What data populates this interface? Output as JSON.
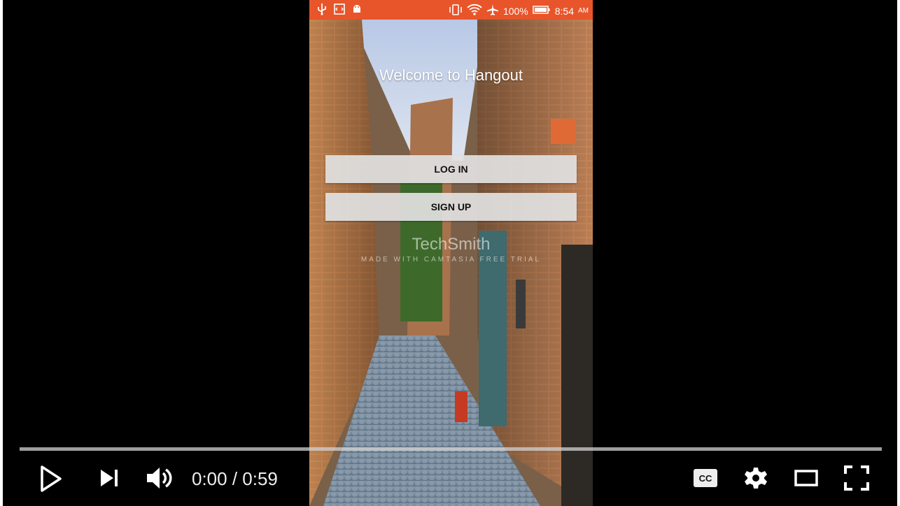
{
  "phone": {
    "status_bar": {
      "battery": "100%",
      "time": "8:54",
      "ampm": "AM"
    },
    "title": "Welcome to Hangout",
    "buttons": {
      "login": "LOG IN",
      "signup": "SIGN UP"
    },
    "watermark": {
      "brand": "TechSmith",
      "subtitle": "MADE WITH CAMTASIA FREE TRIAL"
    }
  },
  "player": {
    "time_display": "0:00 / 0:59",
    "progress": 0.0,
    "icons": [
      "play-icon",
      "next-icon",
      "volume-icon",
      "captions-icon",
      "settings-icon",
      "theater-icon",
      "fullscreen-icon"
    ],
    "colors": {
      "status_bar": "#e8552a",
      "controls": "#ffffff"
    }
  }
}
